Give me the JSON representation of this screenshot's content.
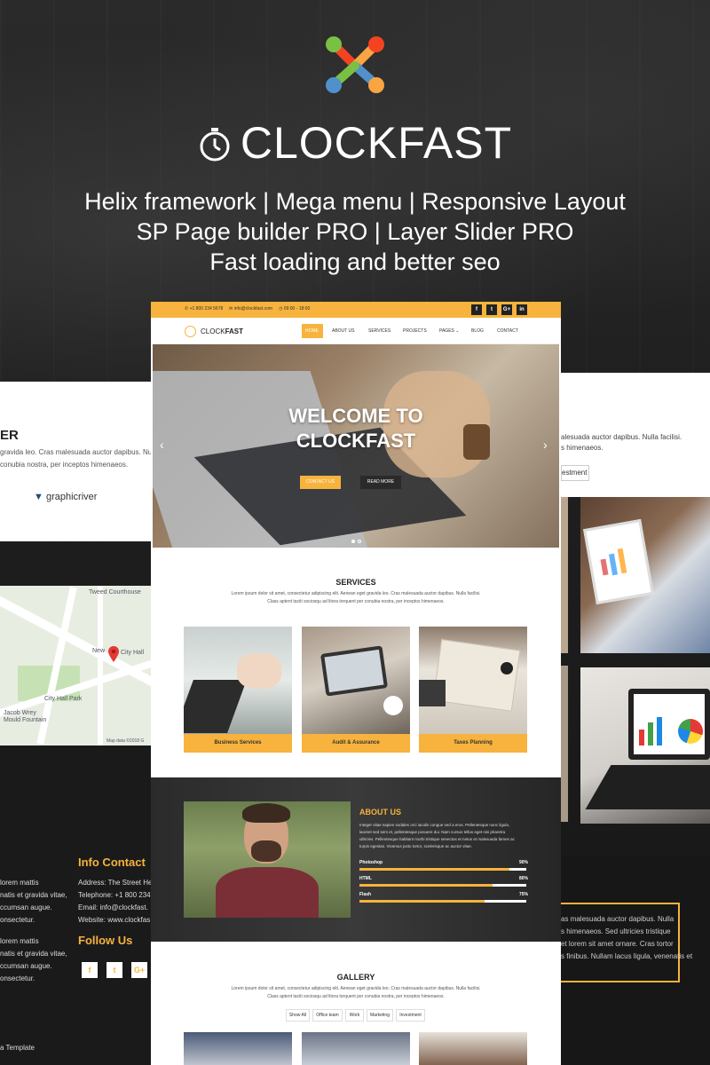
{
  "hero": {
    "brand": "CLOCKFAST",
    "tagline_1": "Helix framework | Mega menu | Responsive Layout",
    "tagline_2": "SP Page builder PRO | Layer Slider PRO",
    "tagline_3": "Fast loading and better seo",
    "icons": [
      "joomla-logo-icon",
      "stopwatch-icon"
    ]
  },
  "left_preview": {
    "heading_fragment": "ER",
    "text_1": "gravida leo. Cras malesuada auctor dapibus. Nulla",
    "text_2": "conubia nostra, per inceptos himenaeos.",
    "partner_logo": "graphicriver",
    "map_labels": [
      "Tweed Courthouse",
      "New",
      "City Hall",
      "City Hall Park",
      "Jacob Wrey",
      "Mould Fountain",
      "Map data ©2018 G"
    ],
    "info_title": "Info Contact",
    "info_lines": [
      "Address:  The Street He",
      "Telephone:  +1 800 234",
      "Email:  info@clockfast.",
      "Website:  www.clockfas"
    ],
    "left_text": [
      "lorem mattis",
      "natis et gravida vitae,",
      "ccumsan augue.",
      "onsectetur."
    ],
    "left_text_2": [
      "lorem mattis",
      "natis et gravida vitae,",
      "ccumsan augue.",
      "onsectetur."
    ],
    "follow_title": "Follow Us",
    "follow_icons": [
      "f",
      "t",
      "G+"
    ],
    "footer_fragment": "a Template"
  },
  "right_preview": {
    "text_1": "alesuada auctor dapibus. Nulla facilisi.",
    "text_2": "s himenaeos.",
    "button_fragment": "estment",
    "dark_text": [
      "as malesuada auctor dapibus. Nulla",
      "s himenaeos. Sed ultricies tristique",
      "et lorem sit amet ornare. Cras tortor",
      "s finibus. Nullam lacus ligula, venenatis et"
    ]
  },
  "main": {
    "topbar": {
      "phone": "+1 800 234 5678",
      "email": "info@clockfast.com",
      "hours": "09:00 - 18:00",
      "social": [
        "f",
        "t",
        "G+",
        "in"
      ]
    },
    "nav": {
      "brand_light": "CLOCK",
      "brand_bold": "FAST",
      "items": [
        "HOME",
        "ABOUT US",
        "SERVICES",
        "PROJECTS",
        "PAGES ⌄",
        "BLOG",
        "CONTACT"
      ],
      "active": "HOME"
    },
    "slider": {
      "title_1": "WELCOME TO",
      "title_2": "CLOCKFAST",
      "btn_contact": "CONTACT US",
      "btn_read": "READ MORE",
      "prev": "‹",
      "next": "›"
    },
    "services": {
      "title": "SERVICES",
      "text_1": "Lorem ipsum dolor sit amet, consectetur adipiscing elit. Aenean eget gravida leo. Cras malesuada auctor dapibus. Nulla facilisi.",
      "text_2": "Class aptent taciti sociosqu ad litora torquent per conubia nostra, per inceptos himenaeos.",
      "cards": [
        "Business Services",
        "Audit & Assurance",
        "Taxes Planning"
      ]
    },
    "about": {
      "title": "ABOUT US",
      "lines": [
        "Integer vitae sapien sodales orci iaculis congue sed a eros. Pellentesque nunc ligula,",
        "laoreet sed sem et, pellentesque posuere dui. Nam cursus tellus eget nisi pharetra",
        "ultricies. Pellentesque habitant morbi tristique senectus et netus et malesuada fames ac",
        "turpis egestas. Vivamus justo tortor, scelerisque ac auctor vitae."
      ],
      "skills": [
        {
          "name": "Photoshop",
          "label": "90%",
          "value": 0.9
        },
        {
          "name": "HTML",
          "label": "80%",
          "value": 0.8
        },
        {
          "name": "Flash",
          "label": "75%",
          "value": 0.75
        }
      ]
    },
    "gallery": {
      "title": "GALLERY",
      "text_1": "Lorem ipsum dolor sit amet, consectetur adipiscing elit. Aenean eget gravida leo. Cras malesuada auctor dapibus. Nulla facilisi.",
      "text_2": "Class aptent taciti sociosqu ad litora torquent per conubia nostra, per inceptos himenaeos.",
      "filters": [
        "Show All",
        "Office team",
        "Work",
        "Marketing",
        "Investment"
      ]
    }
  },
  "colors": {
    "accent": "#f7b33d",
    "dark": "#222222"
  }
}
